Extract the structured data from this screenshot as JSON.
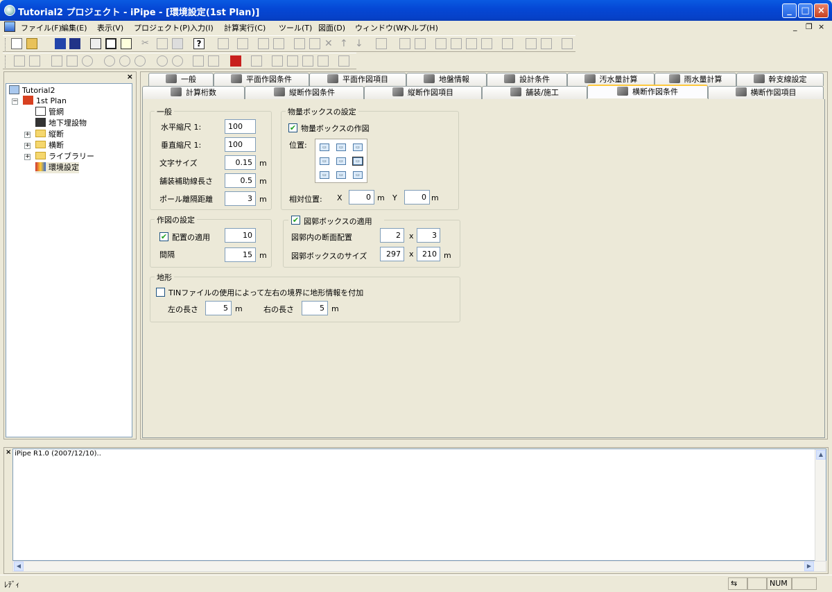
{
  "window": {
    "title": "Tutorial2 プロジェクト - iPipe - [環境設定(1st Plan)]"
  },
  "menu": [
    "ファイル(F)",
    "編集(E)",
    "表示(V)",
    "プロジェクト(P)",
    "入力(I)",
    "計算実行(C)",
    "ツール(T)",
    "図面(D)",
    "ウィンドウ(W)",
    "ヘルプ(H)"
  ],
  "tree": {
    "root": "Tutorial2",
    "plan": "1st Plan",
    "items": [
      "管網",
      "地下埋設物",
      "縦断",
      "横断",
      "ライブラリー",
      "環境設定"
    ]
  },
  "tabs": {
    "row1": [
      "一般",
      "平面作図条件",
      "平面作図項目",
      "地盤情報",
      "設計条件",
      "汚水量計算",
      "雨水量計算",
      "幹支線設定"
    ],
    "row2": [
      "計算桁数",
      "縦断作図条件",
      "縦断作図項目",
      "舗装/施工",
      "横断作図条件",
      "横断作図項目"
    ],
    "active": "横断作図条件"
  },
  "general": {
    "legend": "一般",
    "h_scale_label": "水平縮尺 1:",
    "h_scale": "100",
    "v_scale_label": "垂直縮尺 1:",
    "v_scale": "100",
    "text_size_label": "文字サイズ",
    "text_size": "0.15",
    "pave_line_label": "舗装補助線長さ",
    "pave_line": "0.5",
    "pole_label": "ポール離隔距離",
    "pole": "3",
    "unit": "m"
  },
  "qty_box": {
    "legend": "物量ボックスの設定",
    "draw_label": "物量ボックスの作図",
    "position_label": "位置:",
    "relpos_label": "相対位置:",
    "x_label": "X",
    "x": "0",
    "y_label": "Y",
    "y": "0",
    "unit": "m"
  },
  "drawing": {
    "legend": "作図の設定",
    "layout_label": "配置の適用",
    "layout": "10",
    "interval_label": "間隔",
    "interval": "15",
    "unit": "m"
  },
  "frame_box": {
    "legend": "図郭ボックスの適用",
    "arrange_label": "図郭内の断面配置",
    "arrange_a": "2",
    "arrange_b": "3",
    "size_label": "図郭ボックスのサイズ",
    "size_a": "297",
    "size_b": "210",
    "times": "x",
    "unit": "m"
  },
  "terrain": {
    "legend": "地形",
    "tin_label": "TINファイルの使用によって左右の境界に地形情報を付加",
    "left_label": "左の長さ",
    "left": "5",
    "right_label": "右の長さ",
    "right": "5",
    "unit": "m"
  },
  "output": {
    "text": "iPipe R1.0 (2007/12/10).."
  },
  "status": {
    "left": "ﾚﾃﾞｨ",
    "num": "NUM"
  },
  "colors": {
    "titlebar": "#0548D6",
    "face": "#ECE9D8",
    "active_tab": "#FFC83C"
  }
}
